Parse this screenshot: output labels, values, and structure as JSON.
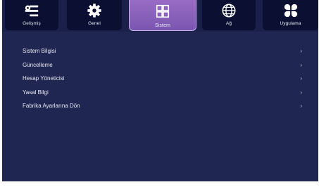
{
  "tabs": [
    {
      "label": "Gelişmiş",
      "icon": "settings-sliders-icon"
    },
    {
      "label": "Genel",
      "icon": "gear-icon"
    },
    {
      "label": "Sistem",
      "icon": "system-grid-icon",
      "active": true
    },
    {
      "label": "Ağ",
      "icon": "globe-icon"
    },
    {
      "label": "Uygulama",
      "icon": "apps-clover-icon"
    }
  ],
  "menu": {
    "items": [
      {
        "label": "Sistem Bilgisi",
        "chevron": "›"
      },
      {
        "label": "Güncelleme",
        "chevron": "›"
      },
      {
        "label": "Hesap Yöneticisi",
        "chevron": "›"
      },
      {
        "label": "Yasal Bilgi",
        "chevron": "›"
      },
      {
        "label": "Fabrika Ayarlarına Dön",
        "chevron": "›"
      }
    ]
  },
  "colors": {
    "background": "#1f2652",
    "tab": "#0b1033",
    "active_tab": "#8b62bd",
    "text": "#e6e8f2"
  }
}
